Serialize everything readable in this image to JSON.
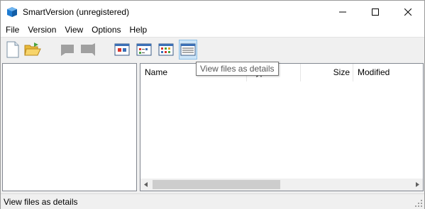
{
  "window": {
    "title": "SmartVersion (unregistered)"
  },
  "menu": [
    "File",
    "Version",
    "View",
    "Options",
    "Help"
  ],
  "toolbar": {
    "buttons": [
      {
        "name": "new-button",
        "icon": "new-file-icon"
      },
      {
        "name": "open-button",
        "icon": "open-folder-icon"
      },
      {
        "name": "back-button",
        "icon": "back-icon",
        "disabled": true
      },
      {
        "name": "forward-button",
        "icon": "forward-icon",
        "disabled": true
      },
      {
        "name": "view-large-icons-button",
        "icon": "large-icons-view-icon"
      },
      {
        "name": "view-small-icons-button",
        "icon": "small-icons-view-icon"
      },
      {
        "name": "view-list-button",
        "icon": "list-view-icon"
      },
      {
        "name": "view-details-button",
        "icon": "details-view-icon",
        "active": true
      }
    ]
  },
  "file_list": {
    "columns": [
      "Name",
      "Type",
      "Size",
      "Modified"
    ]
  },
  "tooltip": "View files as details",
  "status": "View files as details",
  "colors": {
    "accent_active": "#cce4f7",
    "title_icon": "#1e7bd1"
  }
}
